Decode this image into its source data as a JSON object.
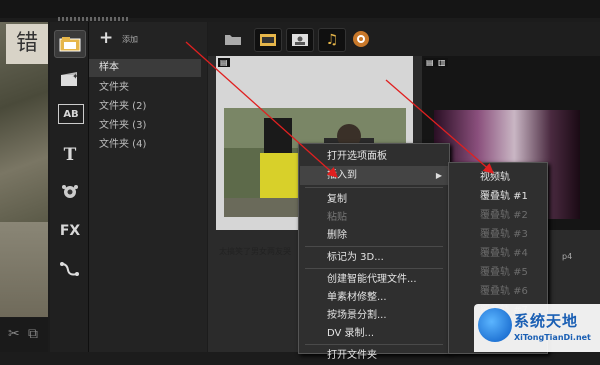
{
  "library": {
    "add_label": "添加",
    "folders": [
      "样本",
      "文件夹",
      "文件夹 (2)",
      "文件夹 (3)",
      "文件夹 (4)"
    ]
  },
  "preview": {
    "sign_text": "错"
  },
  "toolbar": {
    "tools": [
      "media-icon",
      "instant-project-icon",
      "title-icon",
      "text-icon",
      "transition-icon",
      "fx-icon",
      "path-icon"
    ],
    "title_label": "AB",
    "text_label": "T",
    "fx_label": "FX"
  },
  "thumbnails": [
    {
      "caption": "太搞笑了男女两友哭"
    },
    {
      "caption": "p4"
    }
  ],
  "context_menu": {
    "items": [
      {
        "label": "打开选项面板",
        "enabled": true
      },
      {
        "label": "插入到",
        "enabled": true,
        "submenu": true,
        "highlighted": true
      },
      {
        "label": "复制",
        "enabled": true
      },
      {
        "label": "粘贴",
        "enabled": false
      },
      {
        "label": "删除",
        "enabled": true
      },
      {
        "label": "标记为 3D...",
        "enabled": true
      },
      {
        "label": "创建智能代理文件...",
        "enabled": true
      },
      {
        "label": "单素材修整...",
        "enabled": true
      },
      {
        "label": "按场景分割...",
        "enabled": true
      },
      {
        "label": "DV 录制...",
        "enabled": true
      },
      {
        "label": "打开文件夹",
        "enabled": true
      }
    ],
    "submenu_arrow": "▶"
  },
  "submenu": {
    "items": [
      {
        "label": "视频轨",
        "enabled": true
      },
      {
        "label": "覆叠轨 #1",
        "enabled": true
      },
      {
        "label": "覆叠轨 #2",
        "enabled": false
      },
      {
        "label": "覆叠轨 #3",
        "enabled": false
      },
      {
        "label": "覆叠轨 #4",
        "enabled": false
      },
      {
        "label": "覆叠轨 #5",
        "enabled": false
      },
      {
        "label": "覆叠轨 #6",
        "enabled": false
      },
      {
        "label": "覆叠轨 #7",
        "enabled": false
      }
    ]
  },
  "watermark": {
    "title": "系统天地",
    "subtitle": "XiTongTianDi.net"
  },
  "colors": {
    "arrow": "#e02020",
    "highlight": "#444444",
    "panel": "#2f2f2f"
  }
}
